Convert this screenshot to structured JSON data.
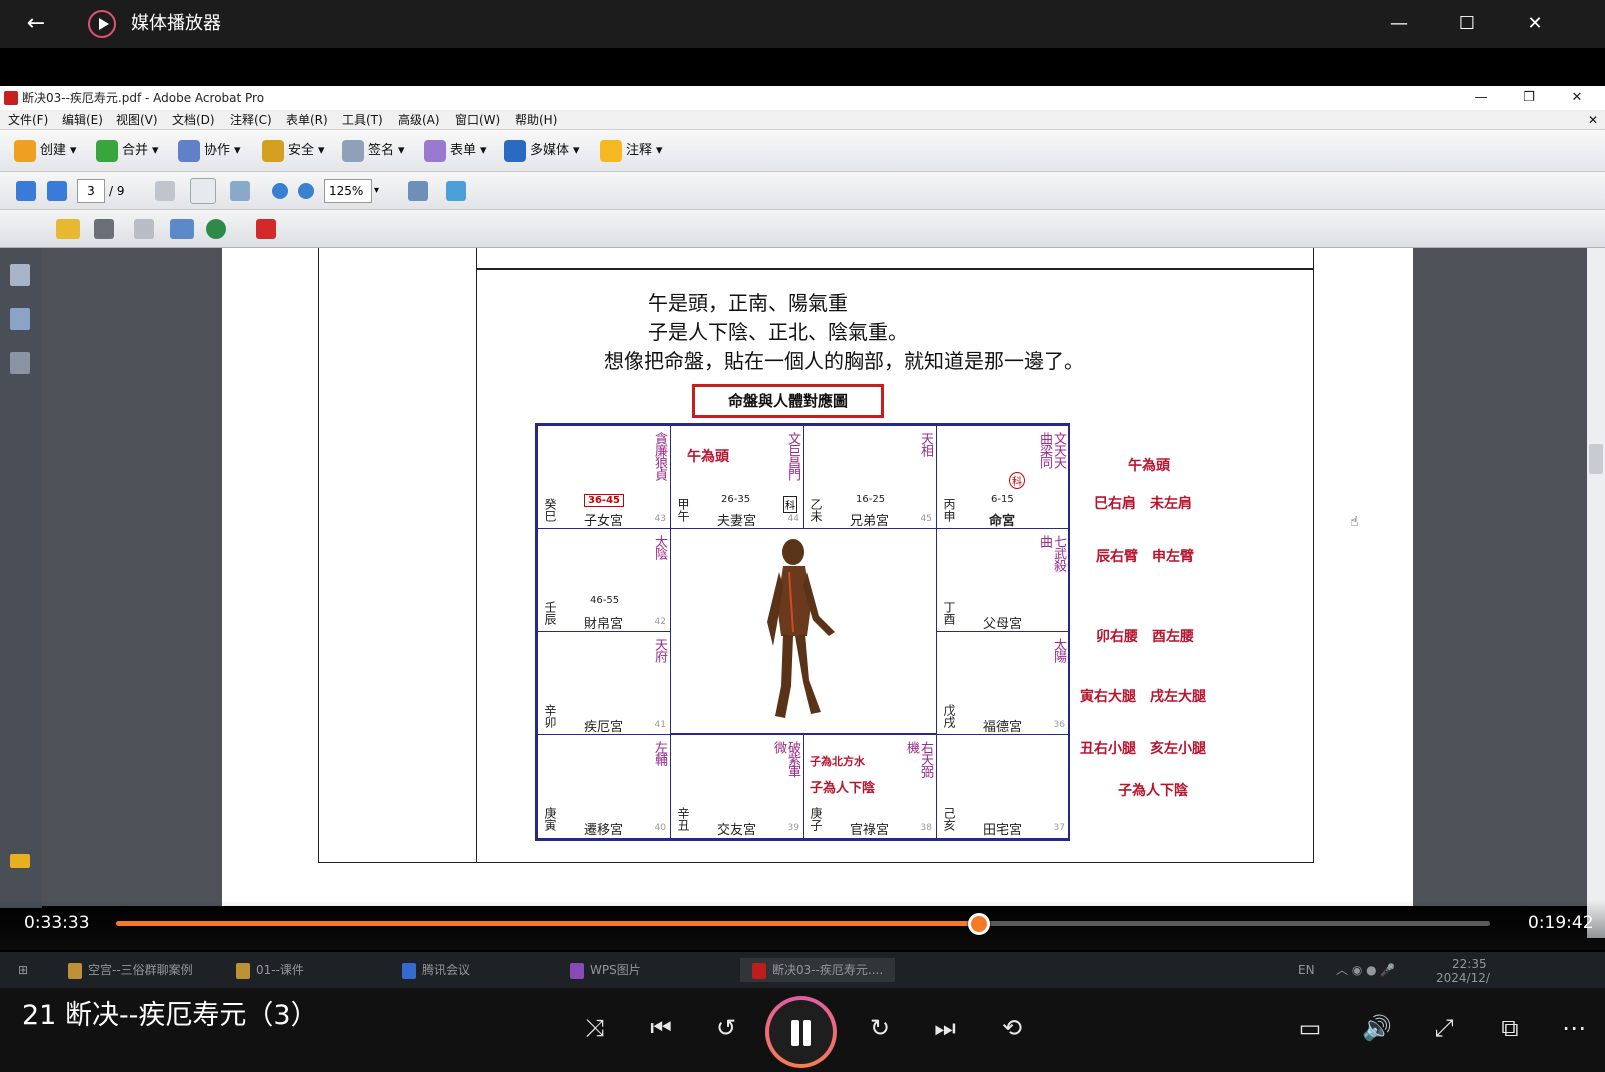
{
  "player": {
    "title": "媒体播放器",
    "back": "←",
    "min": "—",
    "max": "☐",
    "close": "✕"
  },
  "acrobat": {
    "title": "断决03--疾厄寿元.pdf - Adobe Acrobat Pro",
    "menus": [
      "文件(F)",
      "编辑(E)",
      "视图(V)",
      "文档(D)",
      "注释(C)",
      "表单(R)",
      "工具(T)",
      "高级(A)",
      "窗口(W)",
      "帮助(H)"
    ],
    "toolbar": [
      "创建",
      "合并",
      "协作",
      "安全",
      "签名",
      "表单",
      "多媒体",
      "注释"
    ],
    "page_current": "3",
    "page_total": "/ 9",
    "zoom": "125%"
  },
  "doc": {
    "line1": "午是頭，正南、陽氣重",
    "line2": "子是人下陰、正北、陰氣重。",
    "line3": "想像把命盤，貼在一個人的胸部，就知道是那一邊了。",
    "chart_title": "命盤與人體對應圖",
    "cells": {
      "c00": {
        "stars": "貪廉狼貞",
        "gz": "癸巳",
        "name": "子女宮",
        "range": "36-45",
        "idx": "43"
      },
      "c01": {
        "label": "午為頭",
        "stars": "文巨昌門",
        "gz": "甲午",
        "name": "夫妻宮",
        "range": "26-35",
        "idx": "44",
        "mark": "科"
      },
      "c02": {
        "stars": "天相",
        "gz": "乙未",
        "name": "兄弟宮",
        "range": "16-25",
        "idx": "45"
      },
      "c03": {
        "stars": "文天天曲梁同",
        "gz": "丙申",
        "name": "命宮",
        "range": "6-15",
        "mark": "科"
      },
      "c10": {
        "stars": "太陰",
        "gz": "壬辰",
        "name": "財帛宮",
        "range": "46-55",
        "idx": "42"
      },
      "c13": {
        "stars": "七武殺曲",
        "gz": "丁酉",
        "name": "父母宮"
      },
      "c20": {
        "stars": "天府",
        "gz": "辛卯",
        "name": "疾厄宮",
        "idx": "41"
      },
      "c23": {
        "stars": "太陽",
        "gz": "戊戌",
        "name": "福德宮",
        "idx": "36"
      },
      "c30": {
        "stars": "左輔",
        "gz": "庚寅",
        "name": "遷移宮",
        "idx": "40"
      },
      "c31": {
        "stars": "破紫軍微",
        "gz": "辛丑",
        "name": "交友宮",
        "idx": "39"
      },
      "c32": {
        "label1": "子為北方水",
        "label2": "子為人下陰",
        "stars": "右天弼機",
        "gz": "庚子",
        "name": "官祿宮",
        "idx": "38"
      },
      "c33": {
        "gz": "己亥",
        "name": "田宅宮",
        "idx": "37"
      }
    },
    "bodyparts": [
      "午為頭",
      "巳右肩　未左肩",
      "辰右臂　申左臂",
      "卯右腰　酉左腰",
      "寅右大腿　戌左大腿",
      "丑右小腿　亥左小腿",
      "子為人下陰"
    ]
  },
  "playback": {
    "elapsed": "0:33:33",
    "remaining": "0:19:42",
    "progress": 0.628
  },
  "taskbar": {
    "items": [
      "空宫--三俗群聊案例",
      "01--课件",
      "腾讯会议",
      "WPS图片",
      "断决03--疾厄寿元...."
    ],
    "lang": "EN",
    "clock": "22:35",
    "date": "2024/12/"
  },
  "now_playing": "21 断决--疾厄寿元（3）",
  "icons": {
    "shuffle": "shuffle-icon",
    "prev": "previous-icon",
    "rewind": "rewind-10-icon",
    "forward": "forward-30-icon",
    "next": "next-icon",
    "repeat": "repeat-off-icon"
  }
}
